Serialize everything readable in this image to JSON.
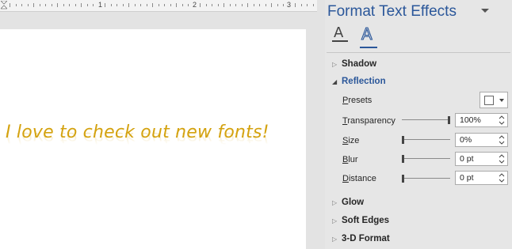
{
  "ruler": {
    "numbers": [
      "1",
      "2",
      "3"
    ]
  },
  "document": {
    "text": "I love to check out new fonts!",
    "text_color": "#d4a20f"
  },
  "pane": {
    "title": "Format Text Effects",
    "tabs": [
      {
        "name": "Text Fill & Outline",
        "icon": "text-fill-outline-icon"
      },
      {
        "name": "Text Effects",
        "icon": "text-effects-icon",
        "active": true
      }
    ],
    "sections": {
      "shadow": "Shadow",
      "reflection": "Reflection",
      "glow": "Glow",
      "soft_edges": "Soft Edges",
      "three_d_format": "3-D Format"
    },
    "reflection": {
      "presets_label_first": "P",
      "presets_label_rest": "resets",
      "transparency_label_first": "T",
      "transparency_label_rest": "ransparency",
      "transparency_value": "100%",
      "transparency_level": 1.0,
      "size_label_first": "S",
      "size_label_rest": "ize",
      "size_value": "0%",
      "size_level": 0.0,
      "blur_label_first": "B",
      "blur_label_rest": "lur",
      "blur_value": "0 pt",
      "blur_level": 0.0,
      "distance_label_first": "D",
      "distance_label_rest": "istance",
      "distance_value": "0 pt",
      "distance_level": 0.0
    },
    "accent_color": "#2b579a"
  }
}
